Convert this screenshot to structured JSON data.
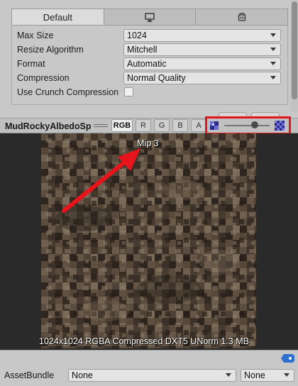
{
  "settings": {
    "tabs": [
      {
        "label": "Default",
        "icon": null
      },
      {
        "label": "",
        "icon": "monitor-icon"
      },
      {
        "label": "",
        "icon": "android-icon"
      }
    ],
    "rows": [
      {
        "label": "Max Size",
        "value": "1024"
      },
      {
        "label": "Resize Algorithm",
        "value": "Mitchell"
      },
      {
        "label": "Format",
        "value": "Automatic"
      },
      {
        "label": "Compression",
        "value": "Normal Quality"
      }
    ],
    "crunch": {
      "label": "Use Crunch Compression",
      "checked": false
    }
  },
  "preview": {
    "title": "MudRockyAlbedoSp",
    "channels": [
      {
        "label": "RGB",
        "active": true
      },
      {
        "label": "R",
        "active": false
      },
      {
        "label": "G",
        "active": false
      },
      {
        "label": "B",
        "active": false
      },
      {
        "label": "A",
        "active": false
      }
    ],
    "mip_label": "Mip 3",
    "info": "1024x1024  RGBA Compressed DXT5 UNorm  1.3 MB",
    "highlight_color": "#e4151c",
    "arrow_color": "#e8141b"
  },
  "asset_bundle": {
    "label": "AssetBundle",
    "name_value": "None",
    "variant_value": "None"
  }
}
